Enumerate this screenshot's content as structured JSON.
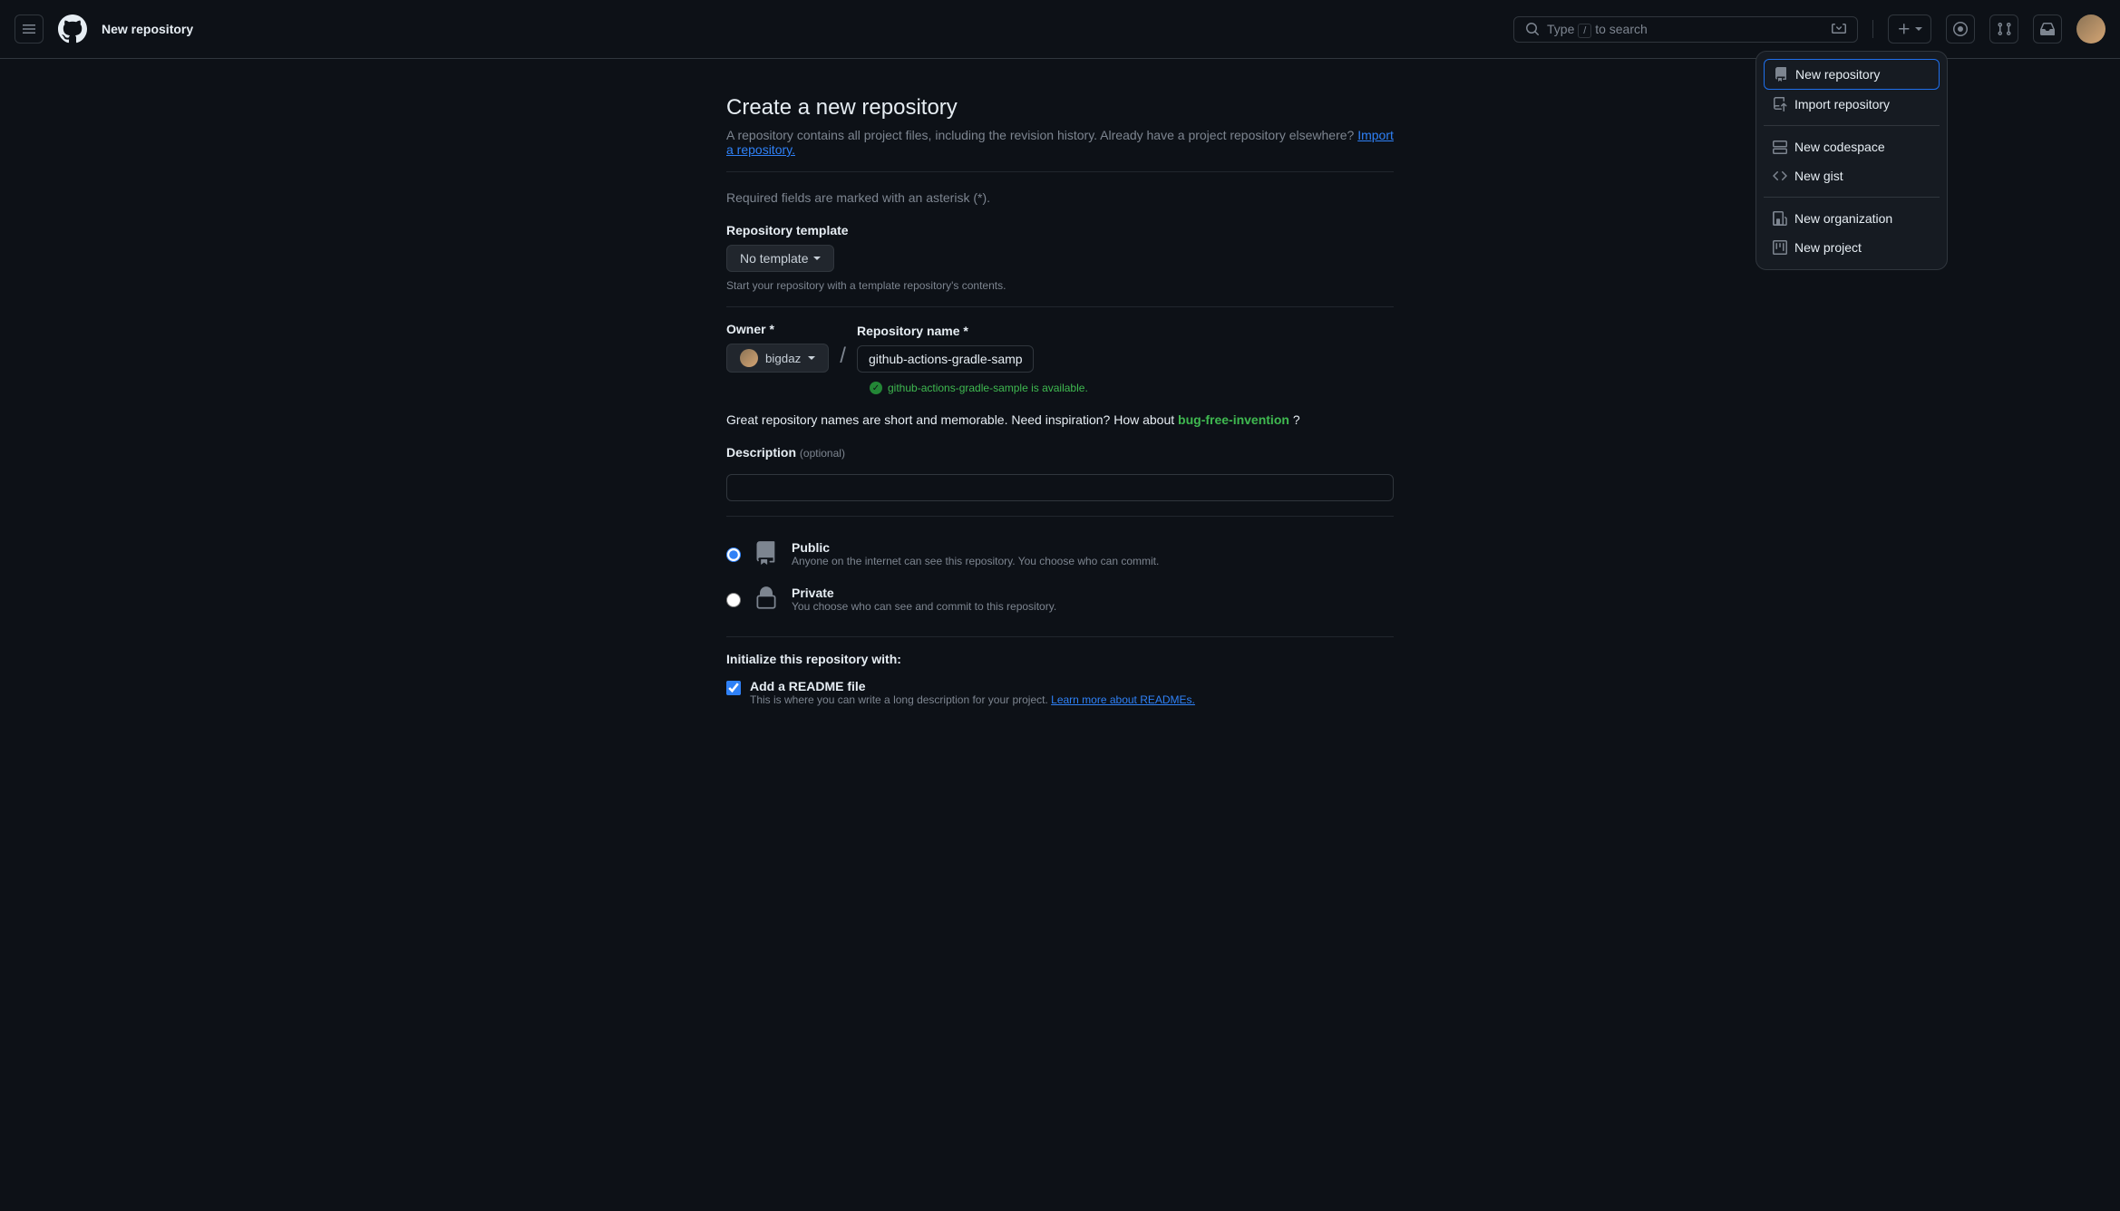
{
  "header": {
    "title": "New repository",
    "search_prefix": "Type",
    "search_kbd": "/",
    "search_suffix": "to search"
  },
  "dropdown": {
    "new_repo": "New repository",
    "import_repo": "Import repository",
    "new_codespace": "New codespace",
    "new_gist": "New gist",
    "new_org": "New organization",
    "new_project": "New project"
  },
  "main": {
    "title": "Create a new repository",
    "subtitle_1": "A repository contains all project files, including the revision history. Already have a project repository elsewhere?",
    "import_link": "Import a repository.",
    "required_note": "Required fields are marked with an asterisk (*).",
    "template_label": "Repository template",
    "template_value": "No template",
    "template_hint": "Start your repository with a template repository's contents.",
    "owner_label": "Owner *",
    "owner_value": "bigdaz",
    "slash": "/",
    "name_label": "Repository name *",
    "name_value": "github-actions-gradle-sample",
    "availability_text": "github-actions-gradle-sample is available.",
    "inspiration_text": "Great repository names are short and memorable. Need inspiration? How about ",
    "suggestion": "bug-free-invention",
    "question_mark": " ?",
    "desc_label": "Description",
    "desc_optional": "(optional)",
    "visibility": {
      "public_title": "Public",
      "public_desc": "Anyone on the internet can see this repository. You choose who can commit.",
      "private_title": "Private",
      "private_desc": "You choose who can see and commit to this repository."
    },
    "init_heading": "Initialize this repository with:",
    "readme_title": "Add a README file",
    "readme_desc": "This is where you can write a long description for your project. ",
    "readme_link": "Learn more about READMEs."
  }
}
